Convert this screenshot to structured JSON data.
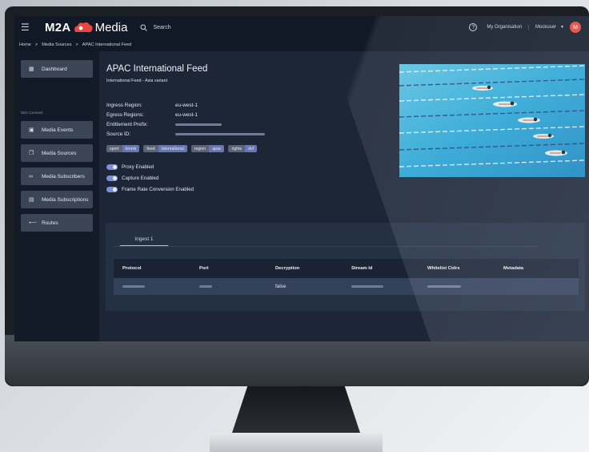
{
  "header": {
    "logo_left": "M2A",
    "logo_right": "Media",
    "search_label": "Search",
    "organisation": "My Organisation",
    "user": "Mockuser",
    "avatar_initial": "M"
  },
  "breadcrumb": [
    "Home",
    ">",
    "Media Sources",
    ">",
    "APAC International Feed"
  ],
  "sidebar": {
    "section_label": "M2A Connect",
    "items": [
      {
        "label": "Dashboard"
      },
      {
        "label": "Media Events"
      },
      {
        "label": "Media Sources"
      },
      {
        "label": "Media Subscribers"
      },
      {
        "label": "Media Subscriptions"
      },
      {
        "label": "Routes"
      }
    ]
  },
  "feed": {
    "title": "APAC International Feed",
    "subtitle": "International Feed - Asia variant",
    "properties": [
      {
        "key": "Ingress Region:",
        "value": "eu-west-1"
      },
      {
        "key": "Egress Regions:",
        "value": "eu-west-1"
      },
      {
        "key": "Entitlement Prefix:",
        "value": ""
      },
      {
        "key": "Source ID:",
        "value": ""
      }
    ],
    "tags": [
      {
        "key": "sport",
        "value": "tennis"
      },
      {
        "key": "feed",
        "value": "international"
      },
      {
        "key": "region",
        "value": "apac"
      },
      {
        "key": "rights",
        "value": "dvf"
      }
    ],
    "toggles": [
      {
        "label": "Proxy Enabled",
        "on": true
      },
      {
        "label": "Capture Enabled",
        "on": true
      },
      {
        "label": "Frame Rate Conversion Enabled",
        "on": true
      }
    ]
  },
  "ingest": {
    "tab": "Ingest 1",
    "columns": [
      "Protocol",
      "Port",
      "Decryption",
      "Stream Id",
      "Whitelist Cidrs",
      "Metadata"
    ],
    "row": {
      "decryption": "false"
    }
  },
  "colors": {
    "accent": "#7d8fd6",
    "brand_red": "#e8473e",
    "tag_value": "#6676b8"
  }
}
